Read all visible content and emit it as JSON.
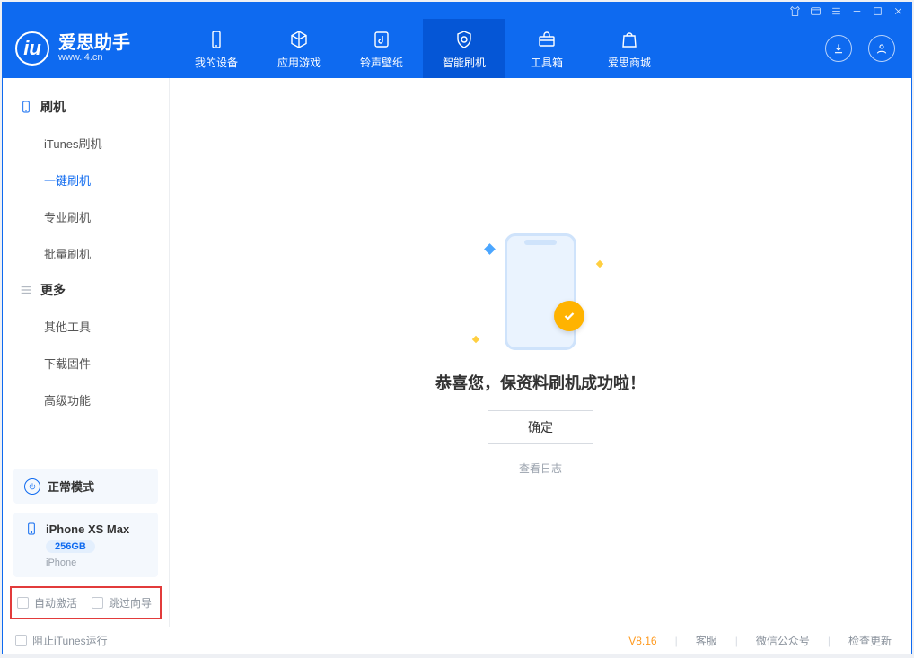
{
  "brand": {
    "title": "爱思助手",
    "subtitle": "www.i4.cn",
    "logo_text": "iu"
  },
  "nav": {
    "items": [
      {
        "label": "我的设备"
      },
      {
        "label": "应用游戏"
      },
      {
        "label": "铃声壁纸"
      },
      {
        "label": "智能刷机"
      },
      {
        "label": "工具箱"
      },
      {
        "label": "爱思商城"
      }
    ]
  },
  "sidebar": {
    "section1_title": "刷机",
    "section1_items": [
      {
        "label": "iTunes刷机"
      },
      {
        "label": "一键刷机"
      },
      {
        "label": "专业刷机"
      },
      {
        "label": "批量刷机"
      }
    ],
    "section2_title": "更多",
    "section2_items": [
      {
        "label": "其他工具"
      },
      {
        "label": "下载固件"
      },
      {
        "label": "高级功能"
      }
    ],
    "mode_label": "正常模式",
    "device_name": "iPhone XS Max",
    "device_capacity": "256GB",
    "device_type": "iPhone",
    "opt_auto_activate": "自动激活",
    "opt_skip_guide": "跳过向导"
  },
  "main": {
    "success_text": "恭喜您，保资料刷机成功啦！",
    "confirm_label": "确定",
    "log_link": "查看日志"
  },
  "footer": {
    "block_itunes": "阻止iTunes运行",
    "version": "V8.16",
    "customer_service": "客服",
    "wechat": "微信公众号",
    "check_update": "检查更新"
  }
}
